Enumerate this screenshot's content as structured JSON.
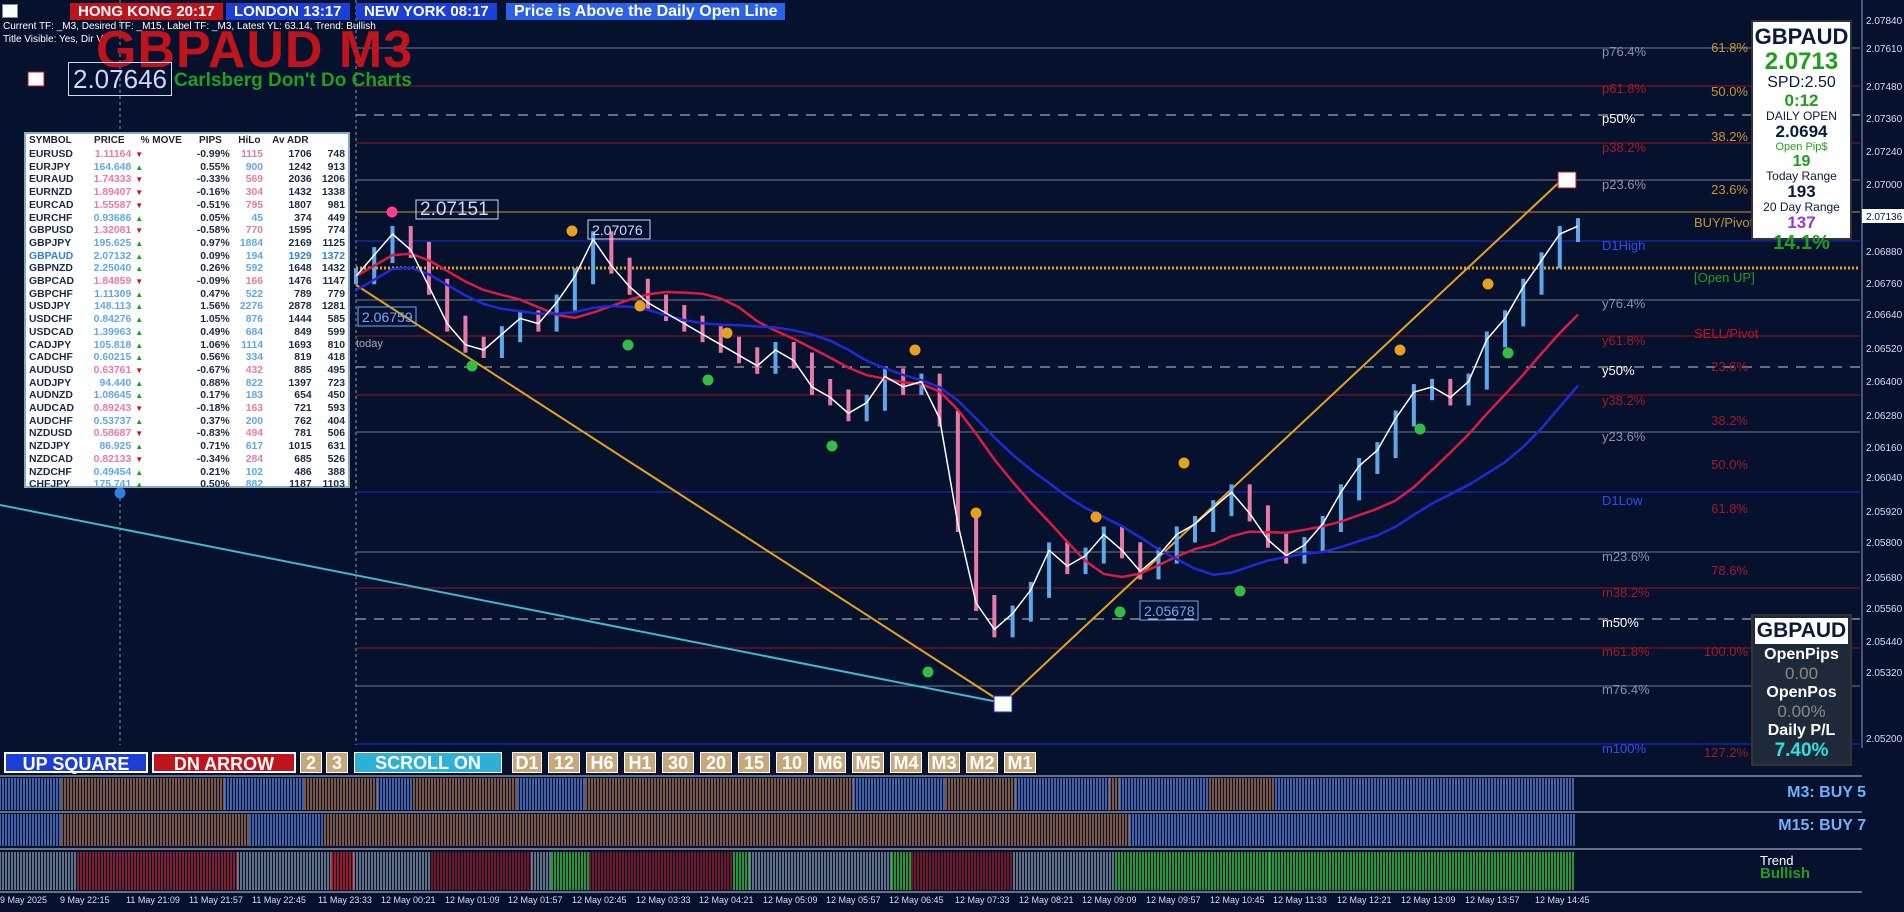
{
  "clocks": [
    {
      "label": "HONG KONG 20:17",
      "bg": "#c0141c"
    },
    {
      "label": "LONDON  13:17",
      "bg": "#1b3fd6"
    },
    {
      "label": "NEW YORK  08:17",
      "bg": "#1b3fd6"
    },
    {
      "label": "Price is Above the Daily Open Line",
      "bg": "#1b3fd6"
    }
  ],
  "info_lines": [
    "Current TF: _M3, Desired TF: _M15, Label TF: _M3, Latest YL: 63.14, Trend: Bullish",
    "Title Visible: Yes, Dir V"
  ],
  "title": {
    "main": "GBPAUD M3",
    "sub": "Carlsberg Don't Do Charts",
    "price_box": "2.07646"
  },
  "watchlist": {
    "headers": [
      "SYMBOL",
      "PRICE",
      "% MOVE",
      "PIPS",
      "HiLo",
      "Av ADR"
    ],
    "rows": [
      {
        "s": "EURUSD",
        "p": "1.11164",
        "d": "dn",
        "m": "-0.99%",
        "pips": "1115",
        "hl": "1706",
        "adr": "748"
      },
      {
        "s": "EURJPY",
        "p": "164.648",
        "d": "up",
        "m": "0.55%",
        "pips": "900",
        "hl": "1242",
        "adr": "913"
      },
      {
        "s": "EURAUD",
        "p": "1.74333",
        "d": "dn",
        "m": "-0.33%",
        "pips": "569",
        "hl": "2036",
        "adr": "1206"
      },
      {
        "s": "EURNZD",
        "p": "1.89407",
        "d": "dn",
        "m": "-0.16%",
        "pips": "304",
        "hl": "1432",
        "adr": "1338"
      },
      {
        "s": "EURCAD",
        "p": "1.55587",
        "d": "dn",
        "m": "-0.51%",
        "pips": "795",
        "hl": "1807",
        "adr": "981"
      },
      {
        "s": "EURCHF",
        "p": "0.93686",
        "d": "up",
        "m": "0.05%",
        "pips": "45",
        "hl": "374",
        "adr": "449"
      },
      {
        "s": "GBPUSD",
        "p": "1.32081",
        "d": "dn",
        "m": "-0.58%",
        "pips": "770",
        "hl": "1595",
        "adr": "774"
      },
      {
        "s": "GBPJPY",
        "p": "195.625",
        "d": "up",
        "m": "0.97%",
        "pips": "1884",
        "hl": "2169",
        "adr": "1125"
      },
      {
        "s": "GBPAUD",
        "p": "2.07132",
        "d": "up",
        "m": "0.09%",
        "pips": "194",
        "hl": "1929",
        "adr": "1372",
        "hl_sym": true
      },
      {
        "s": "GBPNZD",
        "p": "2.25040",
        "d": "up",
        "m": "0.26%",
        "pips": "592",
        "hl": "1648",
        "adr": "1432"
      },
      {
        "s": "GBPCAD",
        "p": "1.84859",
        "d": "dn",
        "m": "-0.09%",
        "pips": "166",
        "hl": "1476",
        "adr": "1147"
      },
      {
        "s": "GBPCHF",
        "p": "1.11309",
        "d": "up",
        "m": "0.47%",
        "pips": "522",
        "hl": "789",
        "adr": "779"
      },
      {
        "s": "USDJPY",
        "p": "148.113",
        "d": "up",
        "m": "1.56%",
        "pips": "2276",
        "hl": "2878",
        "adr": "1281"
      },
      {
        "s": "USDCHF",
        "p": "0.84276",
        "d": "up",
        "m": "1.05%",
        "pips": "876",
        "hl": "1444",
        "adr": "585"
      },
      {
        "s": "USDCAD",
        "p": "1.39963",
        "d": "up",
        "m": "0.49%",
        "pips": "684",
        "hl": "849",
        "adr": "599"
      },
      {
        "s": "CADJPY",
        "p": "105.818",
        "d": "up",
        "m": "1.06%",
        "pips": "1114",
        "hl": "1693",
        "adr": "810"
      },
      {
        "s": "CADCHF",
        "p": "0.60215",
        "d": "up",
        "m": "0.56%",
        "pips": "334",
        "hl": "819",
        "adr": "418"
      },
      {
        "s": "AUDUSD",
        "p": "0.63761",
        "d": "dn",
        "m": "-0.67%",
        "pips": "432",
        "hl": "885",
        "adr": "495"
      },
      {
        "s": "AUDJPY",
        "p": "94.440",
        "d": "up",
        "m": "0.88%",
        "pips": "822",
        "hl": "1397",
        "adr": "723"
      },
      {
        "s": "AUDNZD",
        "p": "1.08645",
        "d": "up",
        "m": "0.17%",
        "pips": "183",
        "hl": "654",
        "adr": "450"
      },
      {
        "s": "AUDCAD",
        "p": "0.89243",
        "d": "dn",
        "m": "-0.18%",
        "pips": "163",
        "hl": "721",
        "adr": "593"
      },
      {
        "s": "AUDCHF",
        "p": "0.53737",
        "d": "up",
        "m": "0.37%",
        "pips": "200",
        "hl": "762",
        "adr": "404"
      },
      {
        "s": "NZDUSD",
        "p": "0.58687",
        "d": "dn",
        "m": "-0.83%",
        "pips": "494",
        "hl": "781",
        "adr": "506"
      },
      {
        "s": "NZDJPY",
        "p": "86.925",
        "d": "up",
        "m": "0.71%",
        "pips": "617",
        "hl": "1015",
        "adr": "631"
      },
      {
        "s": "NZDCAD",
        "p": "0.82133",
        "d": "dn",
        "m": "-0.34%",
        "pips": "284",
        "hl": "685",
        "adr": "526"
      },
      {
        "s": "NZDCHF",
        "p": "0.49454",
        "d": "up",
        "m": "0.21%",
        "pips": "102",
        "hl": "486",
        "adr": "388"
      },
      {
        "s": "CHFJPY",
        "p": "175.741",
        "d": "up",
        "m": "0.50%",
        "pips": "882",
        "hl": "1187",
        "adr": "1103"
      }
    ]
  },
  "info_panel": {
    "symbol": "GBPAUD",
    "price": "2.0713",
    "spread": "SPD:2.50",
    "timer": "0:12",
    "daily_open_label": "DAILY OPEN",
    "daily_open": "2.0694",
    "open_pips_label": "Open Pip$",
    "open_pips": "19",
    "today_range_label": "Today Range",
    "today_range": "193",
    "day20_label": "20 Day Range",
    "day20": "137",
    "pct": "14.1%"
  },
  "pos_panel": {
    "symbol": "GBPAUD",
    "open_pips_label": "OpenPips",
    "open_pips": "0.00",
    "open_pos_label": "OpenPos",
    "open_pos": "0.00%",
    "pl_label": "Daily P/L",
    "pl": "7.40%"
  },
  "buttons": {
    "up_square": "UP SQUARE",
    "dn_arrow": "DN ARROW",
    "b2": "2",
    "b3": "3",
    "scroll": "SCROLL ON",
    "timeframes": [
      "D1",
      "12",
      "H6",
      "H1",
      "30",
      "20",
      "15",
      "10",
      "M6",
      "M5",
      "M4",
      "M3",
      "M2",
      "M1"
    ]
  },
  "strips": {
    "m3": "M3: BUY 5",
    "m15": "M15: BUY 7",
    "trend_label": "Trend",
    "trend_value": "Bullish"
  },
  "time_axis": [
    "9 May 2025",
    "9 May 22:15",
    "11 May 21:09",
    "11 May 21:57",
    "11 May 22:45",
    "11 May 23:33",
    "12 May 00:21",
    "12 May 01:09",
    "12 May 01:57",
    "12 May 02:45",
    "12 May 03:33",
    "12 May 04:21",
    "12 May 05:09",
    "12 May 05:57",
    "12 May 06:45",
    "12 May 07:33",
    "12 May 08:21",
    "12 May 09:09",
    "12 May 09:57",
    "12 May 10:45",
    "12 May 11:33",
    "12 May 12:21",
    "12 May 13:09",
    "12 May 13:57",
    "12 May 14:45"
  ],
  "price_axis": {
    "labels": [
      "2.07840",
      "2.07610",
      "2.07480",
      "2.07360",
      "2.07240",
      "2.07000",
      "2.06880",
      "2.06760",
      "2.06640",
      "2.06520",
      "2.06400",
      "2.06280",
      "2.06160",
      "2.06040",
      "2.05920",
      "2.05800",
      "2.05680",
      "2.05560",
      "2.05440",
      "2.05320",
      "2.05200"
    ],
    "current_price": "2.07136"
  },
  "levels": {
    "fib_top": [
      "p76.4%",
      "p61.8%",
      "p50%",
      "p38.2%",
      "p23.6%"
    ],
    "dhigh": "D1High",
    "dlow": "D1Low",
    "y": [
      "y76.4%",
      "y61.8%",
      "y50%",
      "y38.2%",
      "y23.6%"
    ],
    "m": [
      "m23.6%",
      "m38.2%",
      "m50%",
      "m61.8%",
      "m76.4%",
      "m100%"
    ],
    "right": [
      "61.8%",
      "50.0%",
      "38.2%",
      "23.6%",
      "23.6%",
      "38.2%",
      "50.0%",
      "61.8%",
      "78.6%",
      "100.0%",
      "127.2%"
    ],
    "pivot_labels": {
      "buy": "BUY/Pivot",
      "open_up": "[Open UP]",
      "sell": "SELL/Pivot"
    }
  },
  "price_tags": {
    "a": "2.07151",
    "b": "2.07076",
    "c": "2.06759",
    "d": "2.05678",
    "today": "today"
  },
  "chart_data": {
    "type": "line",
    "title": "GBPAUD M3",
    "ylim": [
      2.0515,
      2.0795
    ],
    "series": [
      {
        "name": "GBPAUD",
        "values": [
          2.0694,
          2.0702,
          2.071,
          2.0704,
          2.069,
          2.0676,
          2.0668,
          2.0666,
          2.0672,
          2.0678,
          2.0676,
          2.0684,
          2.0694,
          2.0708,
          2.0698,
          2.069,
          2.0684,
          2.068,
          2.0676,
          2.0672,
          2.0668,
          2.0664,
          2.066,
          2.0666,
          2.0662,
          2.0652,
          2.0648,
          2.0642,
          2.0646,
          2.0656,
          2.0652,
          2.0654,
          2.064,
          2.06,
          2.057,
          2.056,
          2.0566,
          2.0575,
          2.059,
          2.0584,
          2.0588,
          2.0596,
          2.059,
          2.0582,
          2.0588,
          2.0596,
          2.06,
          2.0606,
          2.0612,
          2.0604,
          2.0594,
          2.0588,
          2.0592,
          2.06,
          2.0612,
          2.0622,
          2.0628,
          2.064,
          2.065,
          2.0652,
          2.0648,
          2.0654,
          2.067,
          2.0678,
          2.069,
          2.07,
          2.071,
          2.0713
        ]
      }
    ]
  }
}
